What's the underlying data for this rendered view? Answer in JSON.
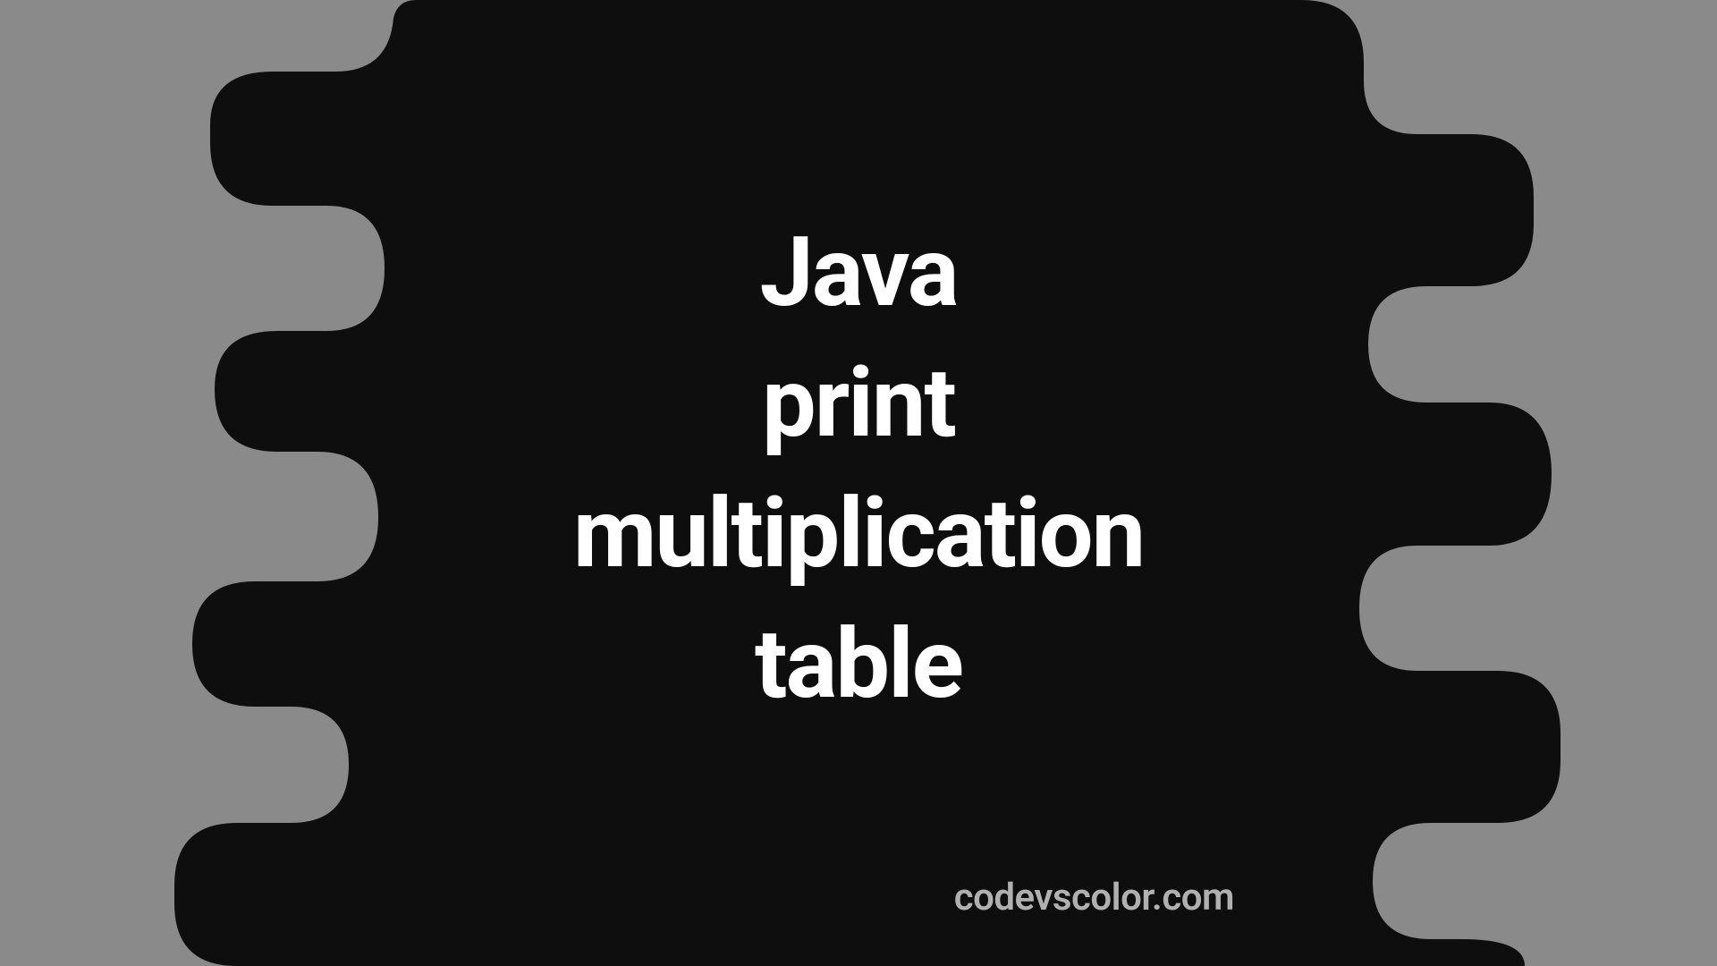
{
  "title": {
    "line1": "Java",
    "line2": "print",
    "line3": "multiplication",
    "line4": "table"
  },
  "footer": "codevscolor.com",
  "colors": {
    "background": "#8a8a8a",
    "blob": "#0e0e0e",
    "text": "#ffffff",
    "footerText": "#b0b0b0"
  }
}
